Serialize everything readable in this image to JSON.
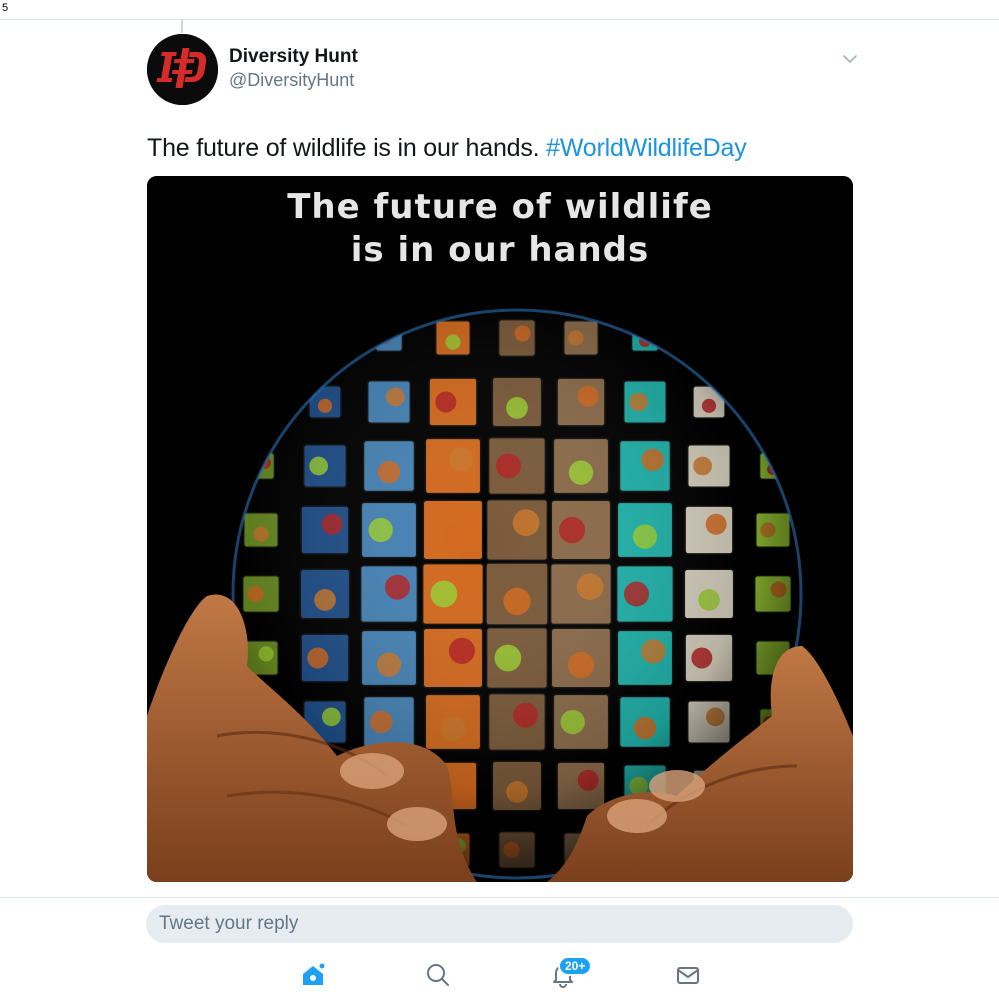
{
  "status_bar": {
    "number": "5"
  },
  "tweet": {
    "display_name": "Diversity Hunt",
    "handle": "@DiversityHunt",
    "text": "The future of wildlife is in our hands. ",
    "hashtag": "#WorldWildlifeDay",
    "media": {
      "caption_line1": "The future of wildlife",
      "caption_line2": "is in our hands"
    }
  },
  "reply": {
    "placeholder": "Tweet your reply"
  },
  "tab_bar": {
    "notifications_badge": "20+",
    "icons": [
      "home-icon",
      "search-icon",
      "bell-icon",
      "mail-icon"
    ]
  },
  "colors": {
    "accent": "#1da1f2",
    "hashtag": "#1b95e0",
    "secondary_text": "#657786",
    "divider": "#e1e8ed"
  }
}
